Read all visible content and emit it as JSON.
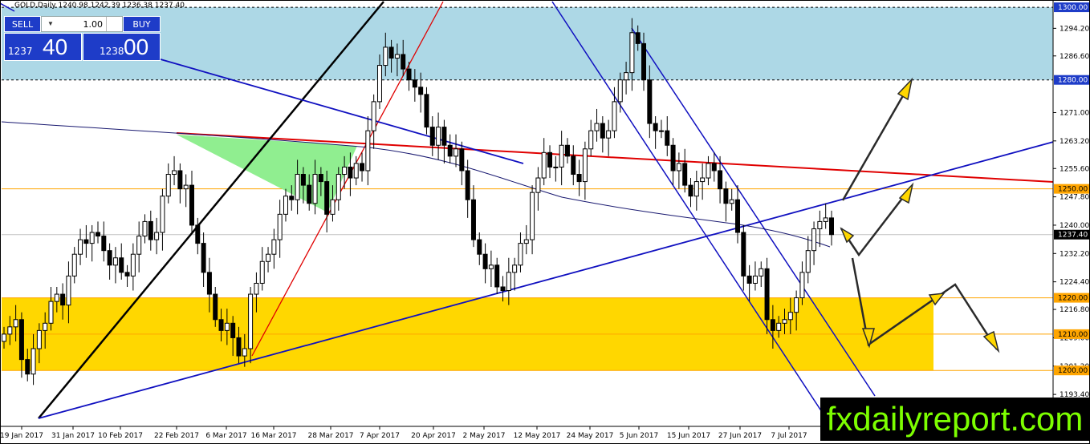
{
  "symbol_info": "GOLD,Daily  1240.98 1242.39 1236.38 1237.40",
  "trade_panel": {
    "sell_label": "SELL",
    "buy_label": "BUY",
    "lot_value": "1.00",
    "sell_price_small": "1237",
    "sell_price_big": "40",
    "buy_price_small": "1238",
    "buy_price_big": "00"
  },
  "watermark": "fxdailyreport.com",
  "colors": {
    "bull": "#ffffff",
    "bear": "#000000",
    "resistance_zone": "#add8e6",
    "support_zone": "#ffd700",
    "trendline_blue": "#0000cd",
    "trendline_red": "#ff0000",
    "ma_line": "#191970",
    "triangle": "#90ee90",
    "arrow": "#ffd700",
    "level_line": "#ffa500"
  },
  "chart_data": {
    "type": "candlestick",
    "instrument": "GOLD",
    "timeframe": "Daily",
    "ylim": [
      1184.6,
      1302.0
    ],
    "y_ticks": [
      1294.2,
      1286.6,
      1271.0,
      1263.2,
      1255.6,
      1247.8,
      1240.0,
      1232.2,
      1224.4,
      1216.8,
      1209.0,
      1201.2,
      1193.4
    ],
    "x_ticks": [
      "19 Jan 2017",
      "31 Jan 2017",
      "10 Feb 2017",
      "22 Feb 2017",
      "6 Mar 2017",
      "16 Mar 2017",
      "28 Mar 2017",
      "7 Apr 2017",
      "20 Apr 2017",
      "2 May 2017",
      "12 May 2017",
      "24 May 2017",
      "5 Jun 2017",
      "15 Jun 2017",
      "27 Jun 2017",
      "7 Jul 2017"
    ],
    "last_price": 1237.4,
    "last_price_label": "1237.40",
    "levels": [
      {
        "price": 1300,
        "label": "1300.00",
        "kind": "resistance"
      },
      {
        "price": 1280,
        "label": "1280.00",
        "kind": "resistance"
      },
      {
        "price": 1250,
        "label": "1250.00",
        "kind": "pivot"
      },
      {
        "price": 1220,
        "label": "1220.00",
        "kind": "support"
      },
      {
        "price": 1210,
        "label": "1210.00",
        "kind": "support"
      },
      {
        "price": 1200,
        "label": "1200.00",
        "kind": "support"
      }
    ],
    "zones": [
      {
        "from": 1280,
        "to": 1300,
        "kind": "resistance"
      },
      {
        "from": 1200,
        "to": 1220,
        "kind": "support"
      }
    ],
    "ohlc_close": [
      1210,
      1212,
      1214,
      1203,
      1199,
      1206,
      1211,
      1213,
      1219,
      1221,
      1218,
      1226,
      1232,
      1236,
      1235,
      1238,
      1237,
      1233,
      1229,
      1231,
      1227,
      1226,
      1232,
      1237,
      1241,
      1236,
      1238,
      1248,
      1254,
      1255,
      1250,
      1251,
      1240,
      1235,
      1227,
      1221,
      1214,
      1211,
      1213,
      1209,
      1204,
      1206,
      1221,
      1224,
      1230,
      1232,
      1236,
      1243,
      1248,
      1247,
      1254,
      1251,
      1246,
      1254,
      1252,
      1243,
      1247,
      1254,
      1256,
      1253,
      1257,
      1255,
      1266,
      1274,
      1284,
      1289,
      1286,
      1287,
      1283,
      1280,
      1278,
      1276,
      1267,
      1262,
      1267,
      1262,
      1259,
      1261,
      1255,
      1247,
      1236,
      1232,
      1228,
      1229,
      1223,
      1222,
      1227,
      1229,
      1235,
      1236,
      1249,
      1253,
      1260,
      1256,
      1256,
      1262,
      1259,
      1254,
      1252,
      1261,
      1266,
      1268,
      1264,
      1266,
      1274,
      1280,
      1282,
      1293,
      1290,
      1280,
      1268,
      1266,
      1266,
      1262,
      1255,
      1257,
      1251,
      1248,
      1252,
      1253,
      1257,
      1255,
      1250,
      1246,
      1247,
      1238,
      1226,
      1224,
      1226,
      1228,
      1214,
      1211,
      1213,
      1214,
      1216,
      1220,
      1227,
      1233,
      1239,
      1241,
      1242,
      1237.4
    ]
  }
}
